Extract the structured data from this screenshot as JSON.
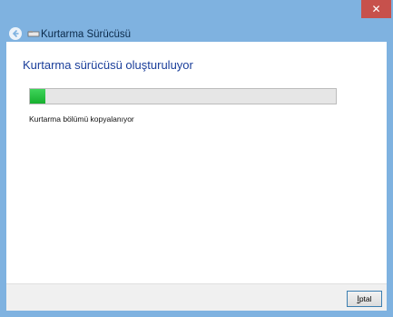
{
  "window": {
    "title": "Kurtarma Sürücüsü",
    "close_glyph": "✕",
    "accent_color": "#7fb2e0",
    "close_color": "#c7514c"
  },
  "content": {
    "heading": "Kurtarma sürücüsü oluşturuluyor",
    "progress": 0.05,
    "progress_color": "#2ac246",
    "status": "Kurtarma bölümü kopyalanıyor"
  },
  "footer": {
    "cancel_mnemonic": "İ",
    "cancel_rest": "ptal"
  },
  "icons": {
    "back": "back-arrow-icon",
    "drive": "usb-drive-icon"
  }
}
